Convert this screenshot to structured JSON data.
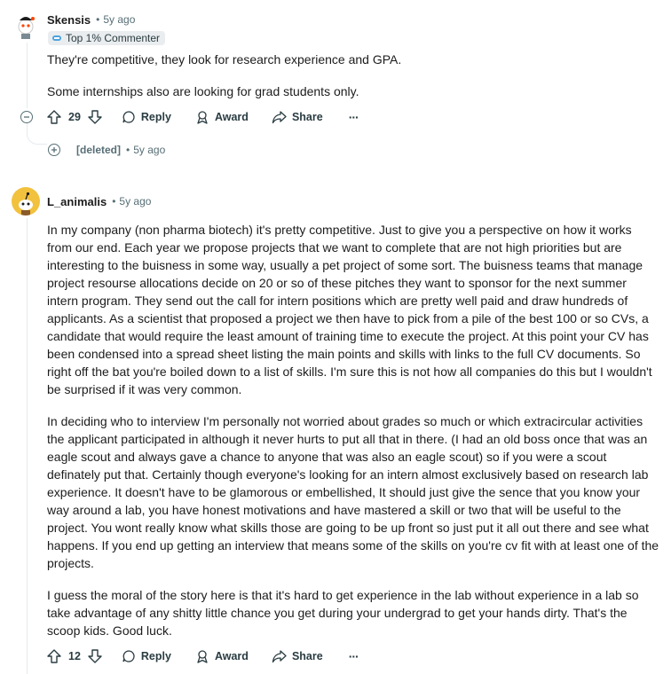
{
  "comment1": {
    "author": "Skensis",
    "time": "5y ago",
    "flair": "Top 1% Commenter",
    "paragraphs": [
      "They're competitive, they look for research experience and GPA.",
      "Some internships also are looking for grad students only."
    ],
    "votes": "29",
    "reply_label": "Reply",
    "award_label": "Award",
    "share_label": "Share",
    "more_label": "···"
  },
  "deleted_reply": {
    "author": "[deleted]",
    "time": "5y ago"
  },
  "comment2": {
    "author": "L_animalis",
    "time": "5y ago",
    "paragraphs": [
      "In my company (non pharma biotech) it's pretty competitive. Just to give you a perspective on how it works from our end. Each year we propose projects that we want to complete that are not high priorities but are interesting to the buisness in some way, usually a pet project of some sort. The buisness teams that manage project resourse allocations decide on 20 or so of these pitches they want to sponsor for the next summer intern program. They send out the call for intern positions which are pretty well paid and draw hundreds of applicants. As a scientist that proposed a project we then have to pick from a pile of the best 100 or so CVs, a candidate that would require the least amount of training time to execute the project. At this point your CV has been condensed into a spread sheet listing the main points and skills with links to the full CV documents. So right off the bat you're boiled down to a list of skills. I'm sure this is not how all companies do this but I wouldn't be surprised if it was very common.",
      "In deciding who to interview I'm personally not worried about grades so much or which extracircular activities the applicant participated in although it never hurts to put all that in there. (I had an old boss once that was an eagle scout and always gave a chance to anyone that was also an eagle scout) so if you were a scout definately put that. Certainly though everyone's looking for an intern almost exclusively based on research lab experience. It doesn't have to be glamorous or embellished, It should just give the sence that you know your way around a lab, you have honest motivations and have mastered a skill or two that will be useful to the project. You wont really know what skills those are going to be up front so just put it all out there and see what happens. If you end up getting an interview that means some of the skills on you're cv fit with at least one of the projects.",
      "I guess the moral of the story here is that it's hard to get experience in the lab without experience in a lab so take advantage of any shitty little chance you get during your undergrad to get your hands dirty. That's the scoop kids. Good luck."
    ],
    "votes": "12",
    "reply_label": "Reply",
    "award_label": "Award",
    "share_label": "Share",
    "more_label": "···"
  },
  "colors": {
    "meta": "#576f76",
    "thread_line": "#e5ebee",
    "avatar2_bg": "#f2c13d"
  }
}
